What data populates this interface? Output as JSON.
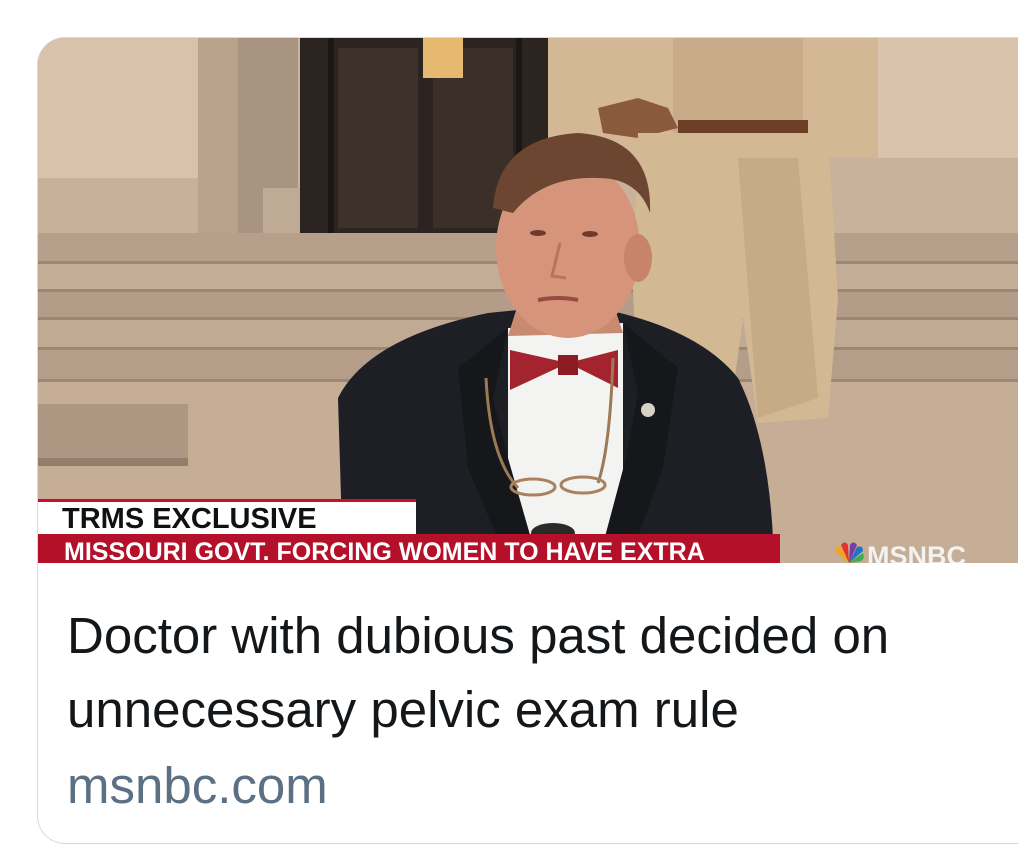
{
  "link_card": {
    "image": {
      "alt": "",
      "lower_third": {
        "tag": "TRMS EXCLUSIVE",
        "ticker": "MISSOURI GOVT. FORCING WOMEN TO HAVE EXTRA",
        "network": "MSNBC",
        "accent_red": "#b5102a"
      }
    },
    "title": "Doctor with dubious past decided on unnecessary pelvic exam rule",
    "domain": "msnbc.com"
  },
  "colors": {
    "title_text": "#14171a",
    "domain_text": "#5b7083",
    "card_border": "#d4dbe0"
  }
}
